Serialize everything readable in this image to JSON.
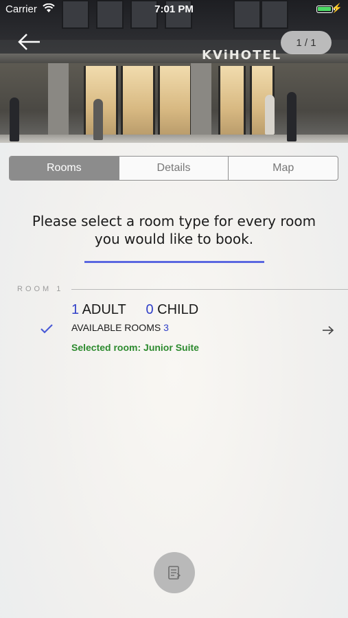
{
  "status_bar": {
    "carrier": "Carrier",
    "time": "7:01 PM"
  },
  "hero": {
    "hotel_sign": "KViHOTEL",
    "photo_counter": "1 / 1"
  },
  "tabs": [
    {
      "label": "Rooms",
      "active": true
    },
    {
      "label": "Details",
      "active": false
    },
    {
      "label": "Map",
      "active": false
    }
  ],
  "instruction": {
    "line1": "Please select a room type for every room",
    "line2": "you would like to book."
  },
  "room": {
    "label": "ROOM 1",
    "adults_count": "1",
    "adults_label": "ADULT",
    "children_count": "0",
    "children_label": "CHILD",
    "available_label": "AVAILABLE ROOMS",
    "available_count": "3",
    "selected_text": "Selected room: Junior Suite"
  },
  "colors": {
    "accent_blue": "#3040c8",
    "underline_blue": "#5a67e0",
    "selected_green": "#2c8a2e",
    "active_tab": "#8c8c8c"
  },
  "icons": {
    "back": "arrow-left-icon",
    "wifi": "wifi-icon",
    "battery": "battery-icon",
    "check": "checkmark-icon",
    "row_arrow": "arrow-right-icon",
    "fab": "booking-summary-icon"
  }
}
